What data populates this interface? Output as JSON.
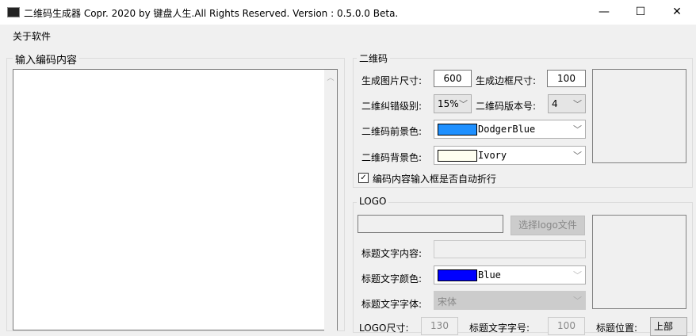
{
  "window": {
    "title": "二维码生成器  Copr. 2020 by 键盘人生.All Rights Reserved.  Version : 0.5.0.0 Beta.",
    "minimize": "—",
    "maximize": "☐",
    "close": "✕"
  },
  "menu": {
    "about": "关于软件"
  },
  "input_group": {
    "label": "输入编码内容",
    "content": ""
  },
  "qr_group": {
    "label": "二维码",
    "size_label": "生成图片尺寸:",
    "size_value": "600",
    "border_label": "生成边框尺寸:",
    "border_value": "100",
    "ecc_label": "二维纠错级别:",
    "ecc_value": "15%",
    "version_label": "二维码版本号:",
    "version_value": "4",
    "fg_label": "二维码前景色:",
    "fg_value": "DodgerBlue",
    "fg_color": "#1e90ff",
    "bg_label": "二维码背景色:",
    "bg_value": "Ivory",
    "bg_color": "#fffff0",
    "wrap_label": "编码内容输入框是否自动折行",
    "wrap_checked": true
  },
  "logo_group": {
    "label": "LOGO",
    "path_value": "",
    "choose_button": "选择logo文件",
    "title_text_label": "标题文字内容:",
    "title_text_value": "",
    "title_color_label": "标题文字颜色:",
    "title_color_value": "Blue",
    "title_color": "#0000ff",
    "title_font_label": "标题文字字体:",
    "title_font_value": "宋体",
    "logo_size_label": "LOGO尺寸:",
    "logo_size_value": "130",
    "title_font_size_label": "标题文字字号:",
    "title_font_size_value": "100",
    "title_pos_label": "标题位置:",
    "title_pos_value": "上部"
  }
}
